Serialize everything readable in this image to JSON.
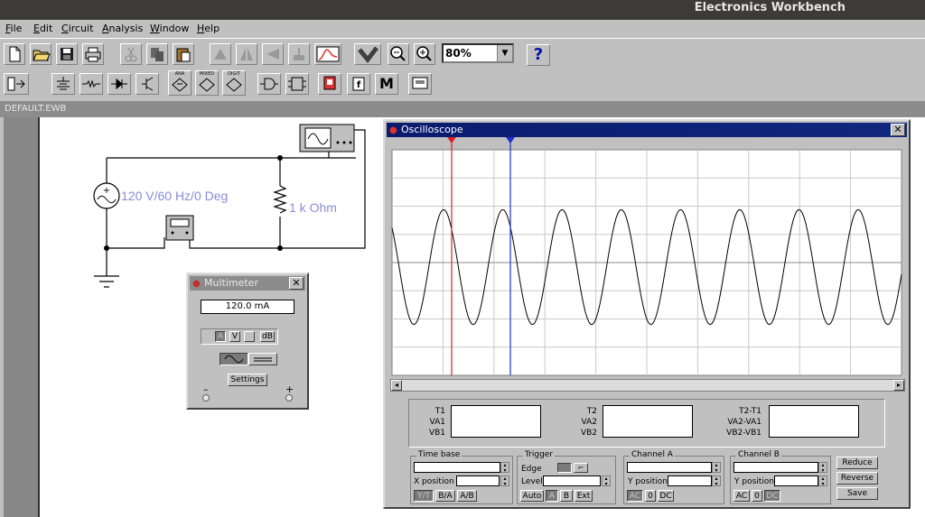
{
  "app_title": "Electronics Workbench",
  "menu": [
    "File",
    "Edit",
    "Circuit",
    "Analysis",
    "Window",
    "Help"
  ],
  "zoom": "80%",
  "help_label": "?",
  "toolbar2_labels": {
    "analog": "ANA",
    "mixed": "MIXED",
    "digital": "DIGIT",
    "miscellaneous": "M"
  },
  "document_title": "DEFAULT.EWB",
  "circuit": {
    "source_label": "120 V/60 Hz/0 Deg",
    "resistor_label": "1 k Ohm"
  },
  "multimeter": {
    "title": "Multimeter",
    "reading": "120.0  mA",
    "modes": [
      "A",
      "V",
      "",
      "dB"
    ],
    "settings_label": "Settings",
    "minus": "–",
    "plus": "+"
  },
  "oscilloscope": {
    "title": "Oscilloscope",
    "readout": {
      "left_labels": [
        "T1",
        "VA1",
        "VB1"
      ],
      "mid_labels": [
        "T2",
        "VA2",
        "VB2"
      ],
      "right_labels": [
        "T2-T1",
        "VA2-VA1",
        "VB2-VB1"
      ]
    },
    "timebase": {
      "title": "Time base",
      "x_position": "X position",
      "buttons": [
        "Y/T",
        "B/A",
        "A/B"
      ]
    },
    "trigger": {
      "title": "Trigger",
      "edge": "Edge",
      "level": "Level",
      "buttons": [
        "Auto",
        "A",
        "B",
        "Ext"
      ]
    },
    "channel_a": {
      "title": "Channel A",
      "y_position": "Y position",
      "buttons": [
        "AC",
        "0",
        "DC"
      ]
    },
    "channel_b": {
      "title": "Channel B",
      "y_position": "Y position",
      "buttons": [
        "AC",
        "0",
        "DC"
      ]
    },
    "actions": [
      "Reduce",
      "Reverse",
      "Save"
    ],
    "colors": {
      "cursor1": "#e02020",
      "cursor2": "#2030d0",
      "grid": "#c8c8c8",
      "trace": "#000000"
    }
  }
}
